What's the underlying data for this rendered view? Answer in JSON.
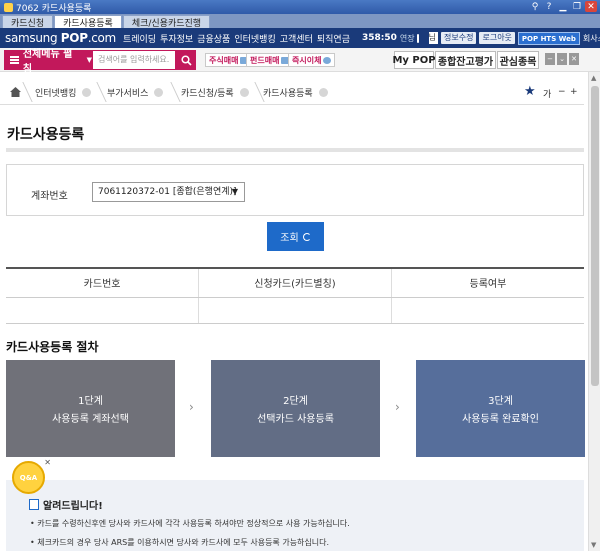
{
  "window": {
    "title": "7062 카드사용등록"
  },
  "tabs": [
    {
      "label": "카드신청"
    },
    {
      "label": "카드사용등록"
    },
    {
      "label": "체크/신용카드진행"
    }
  ],
  "header": {
    "logo_prefix": "samsung",
    "logo_main": "POP",
    "logo_suffix": ".com",
    "nav": [
      "트레이딩",
      "투자정보",
      "금융상품",
      "인터넷뱅킹",
      "고객센터",
      "퇴직연금"
    ],
    "clock": "358:50",
    "extend": "연장",
    "user_suffix": "님",
    "info_edit": "정보수정",
    "logout": "로그아웃",
    "hts": "POP HTS Web",
    "company_intro": "회사소개"
  },
  "menubar": {
    "all_menu": "전체메뉴 펼침",
    "search_placeholder": "검색어를 입력하세요.",
    "quick": [
      "주식매매",
      "펀드매매",
      "즉시이체"
    ],
    "right_buttons": [
      "My POP",
      "종합잔고평가",
      "관심종목"
    ]
  },
  "breadcrumb": {
    "items": [
      "인터넷뱅킹",
      "부가서비스",
      "카드신청/등록",
      "카드사용등록"
    ],
    "font_label": "가",
    "minus": "−",
    "plus": "+"
  },
  "page": {
    "title": "카드사용등록",
    "account_label": "계좌번호",
    "account_value": "7061120372-01 [종합(은행연계)]",
    "search_button": "조회"
  },
  "table": {
    "columns": [
      "카드번호",
      "신청카드(카드별칭)",
      "등록여부"
    ]
  },
  "procedure": {
    "title": "카드사용등록 절차",
    "steps": [
      {
        "step": "1단계",
        "desc": "사용등록 계좌선택",
        "color": "#707179"
      },
      {
        "step": "2단계",
        "desc": "선택카드 사용등록",
        "color": "#626d85"
      },
      {
        "step": "3단계",
        "desc": "사용등록 완료확인",
        "color": "#566e9b"
      }
    ]
  },
  "notice": {
    "title": "알려드립니다!",
    "lines": [
      "카드를 수령하신후엔 당사와 카드사에 각각 사용등록 하셔야만 정상적으로 사용 가능하십니다.",
      "체크카드의 경우 당사 ARS를 이용하시면 당사와 카드사에 모두 사용등록 가능하십니다."
    ]
  },
  "qna": {
    "label": "Q&A"
  }
}
